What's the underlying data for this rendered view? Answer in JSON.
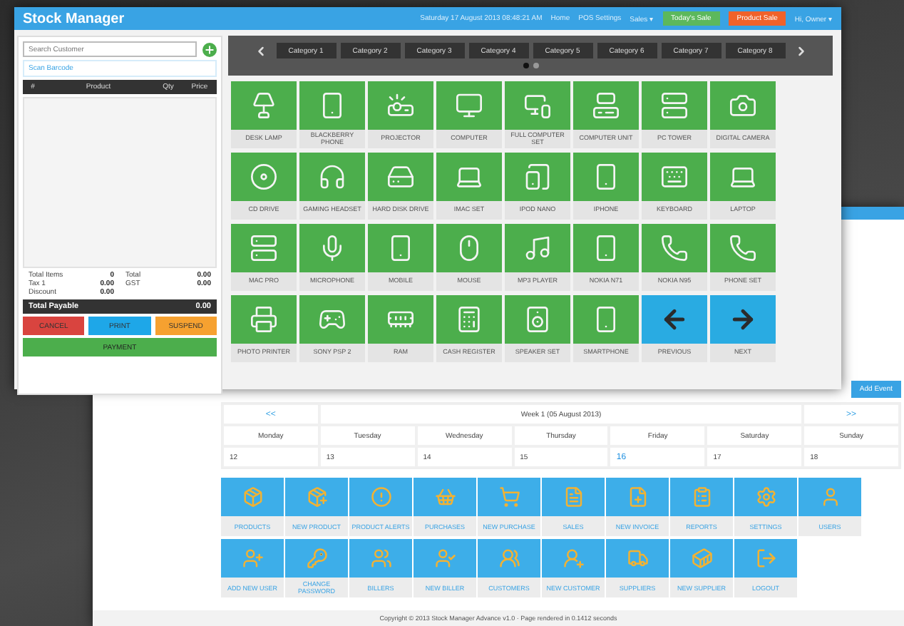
{
  "pos_window": {
    "title": "Stock Manager",
    "nav": [
      {
        "kind": "text",
        "label": "Saturday 17 August 2013 08:48:21 AM"
      },
      {
        "kind": "text",
        "label": "Home"
      },
      {
        "kind": "text",
        "label": "POS Settings"
      },
      {
        "kind": "menu",
        "label": "Sales ▾"
      },
      {
        "kind": "green",
        "label": "Today's Sale"
      },
      {
        "kind": "orange",
        "label": "Product Sale"
      },
      {
        "kind": "menu",
        "label": "Hi, Owner ▾"
      }
    ],
    "customer_field": {
      "placeholder": "Search Customer"
    },
    "barcode_link": "Scan Barcode",
    "cart_columns": [
      "#",
      "Product",
      "Qty",
      "Price"
    ],
    "totals": [
      {
        "label": "Total Items",
        "value": "0"
      },
      {
        "label": "Total",
        "value": "0.00"
      },
      {
        "label": "Tax 1",
        "value": "0.00"
      },
      {
        "label": "GST",
        "value": "0.00"
      },
      {
        "label": "Discount",
        "value": "0.00"
      }
    ],
    "total_payable": {
      "label": "Total Payable",
      "value": "0.00"
    },
    "actions": [
      {
        "kind": "cancel",
        "label": "CANCEL"
      },
      {
        "kind": "print",
        "label": "PRINT"
      },
      {
        "kind": "suspend",
        "label": "SUSPEND"
      }
    ],
    "payment_button": "PAYMENT",
    "categories": [
      "Category 1",
      "Category 2",
      "Category 3",
      "Category 4",
      "Category 5",
      "Category 6",
      "Category 7",
      "Category 8"
    ],
    "category_pages": [
      {
        "selected": true
      },
      {
        "selected": false
      }
    ],
    "products": [
      {
        "kind": "product",
        "label": "DESK LAMP"
      },
      {
        "kind": "product",
        "label": "BLACKBERRY PHONE"
      },
      {
        "kind": "product",
        "label": "PROJECTOR"
      },
      {
        "kind": "product",
        "label": "COMPUTER"
      },
      {
        "kind": "product",
        "label": "FULL COMPUTER SET"
      },
      {
        "kind": "product",
        "label": "COMPUTER UNIT"
      },
      {
        "kind": "product",
        "label": "PC TOWER"
      },
      {
        "kind": "product",
        "label": "DIGITAL CAMERA"
      },
      {
        "kind": "product",
        "label": "CD DRIVE"
      },
      {
        "kind": "product",
        "label": "GAMING HEADSET"
      },
      {
        "kind": "product",
        "label": "HARD DISK DRIVE"
      },
      {
        "kind": "product",
        "label": "IMAC SET"
      },
      {
        "kind": "product",
        "label": "IPOD NANO"
      },
      {
        "kind": "product",
        "label": "IPHONE"
      },
      {
        "kind": "product",
        "label": "KEYBOARD"
      },
      {
        "kind": "product",
        "label": "LAPTOP"
      },
      {
        "kind": "product",
        "label": "MAC PRO"
      },
      {
        "kind": "product",
        "label": "MICROPHONE"
      },
      {
        "kind": "product",
        "label": "MOBILE"
      },
      {
        "kind": "product",
        "label": "MOUSE"
      },
      {
        "kind": "product",
        "label": "MP3 PLAYER"
      },
      {
        "kind": "product",
        "label": "NOKIA N71"
      },
      {
        "kind": "product",
        "label": "NOKIA N95"
      },
      {
        "kind": "product",
        "label": "PHONE SET"
      },
      {
        "kind": "product",
        "label": "PHOTO PRINTER"
      },
      {
        "kind": "product",
        "label": "SONY PSP 2"
      },
      {
        "kind": "product",
        "label": "RAM"
      },
      {
        "kind": "product",
        "label": "CASH REGISTER"
      },
      {
        "kind": "product",
        "label": "SPEAKER SET"
      },
      {
        "kind": "product",
        "label": "SMARTPHONE"
      },
      {
        "kind": "previous",
        "label": "PREVIOUS"
      },
      {
        "kind": "next",
        "label": "NEXT"
      }
    ]
  },
  "dashboard_window": {
    "add_event_button": "Add Event",
    "calendar": {
      "prev": "<<",
      "title": "Week 1 (05 August 2013)",
      "next": ">>",
      "days": [
        {
          "name": "Monday",
          "date": "12",
          "today": false
        },
        {
          "name": "Tuesday",
          "date": "13",
          "today": false
        },
        {
          "name": "Wednesday",
          "date": "14",
          "today": false
        },
        {
          "name": "Thursday",
          "date": "15",
          "today": false
        },
        {
          "name": "Friday",
          "date": "16",
          "today": true
        },
        {
          "name": "Saturday",
          "date": "17",
          "today": false
        },
        {
          "name": "Sunday",
          "date": "18",
          "today": false
        }
      ]
    },
    "menu": [
      "PRODUCTS",
      "NEW PRODUCT",
      "PRODUCT ALERTS",
      "PURCHASES",
      "NEW PURCHASE",
      "SALES",
      "NEW INVOICE",
      "REPORTS",
      "SETTINGS",
      "USERS",
      "ADD NEW USER",
      "CHANGE PASSWORD",
      "BILLERS",
      "NEW BILLER",
      "CUSTOMERS",
      "NEW CUSTOMER",
      "SUPPLIERS",
      "NEW SUPPLIER",
      "LOGOUT"
    ],
    "footer": "Copyright © 2013 Stock Manager Advance v1.0 · Page rendered in 0.1412 seconds"
  }
}
